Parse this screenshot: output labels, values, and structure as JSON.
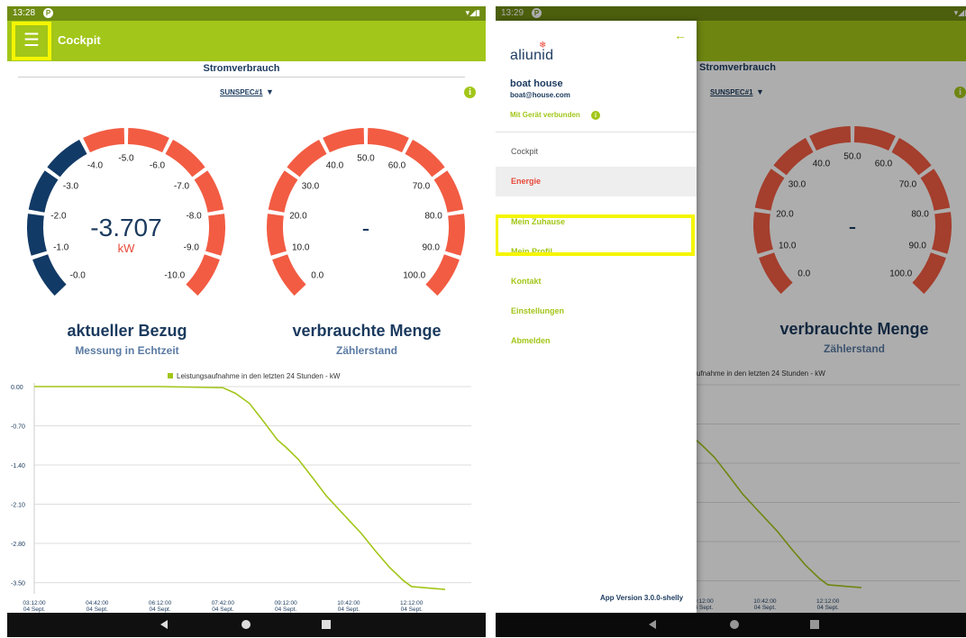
{
  "colors": {
    "accent": "#a2c619",
    "statusbar": "#6f8c13",
    "navy": "#1b3a5e",
    "gauge_red": "#f25c43",
    "gauge_blue": "#123a66",
    "highlight": "#f5f502"
  },
  "left_screen": {
    "status": {
      "time": "13:28",
      "icon": "P"
    },
    "appbar": {
      "menu_icon": "hamburger-icon",
      "title": "Cockpit"
    },
    "section_title": "Stromverbrauch",
    "device": "SUNSPEC#1",
    "device_caret": "▼",
    "info_icon": "i",
    "gauge1": {
      "ticks": [
        "-0.0",
        "-1.0",
        "-2.0",
        "-3.0",
        "-4.0",
        "-5.0",
        "-6.0",
        "-7.0",
        "-8.0",
        "-9.0",
        "-10.0"
      ],
      "value": "-3.707",
      "numeric_value": -3.707,
      "range": [
        0,
        -10
      ],
      "unit": "kW",
      "title": "aktueller Bezug",
      "subtitle": "Messung in Echtzeit"
    },
    "gauge2": {
      "ticks": [
        "0.0",
        "10.0",
        "20.0",
        "30.0",
        "40.0",
        "50.0",
        "60.0",
        "70.0",
        "80.0",
        "90.0",
        "100.0"
      ],
      "value": "-",
      "title": "verbrauchte Menge",
      "subtitle": "Zählerstand"
    },
    "legend": "Leistungsaufnahme in den letzten 24 Stunden - kW"
  },
  "right_screen": {
    "status": {
      "time": "13:29",
      "icon": "P"
    },
    "back_icon": "←",
    "logo": "aliunid",
    "user_name": "boat house",
    "user_email": "boat@house.com",
    "connection": "Mit Gerät verbunden",
    "connection_info": "i",
    "menu": [
      {
        "label": "Cockpit"
      },
      {
        "label": "Energie"
      },
      {
        "label": "Mein Zuhause"
      },
      {
        "label": "Mein Profil"
      },
      {
        "label": "Kontakt"
      },
      {
        "label": "Einstellungen"
      },
      {
        "label": "Abmelden"
      }
    ],
    "version": "App Version 3.0.0-shelly",
    "bg_section_title": "Stromverbrauch",
    "bg_gauge_title": "verbrauchte Menge",
    "bg_gauge_sub": "Zählerstand",
    "bg_legend": "ufnahme in den letzten 24 Stunden - kW"
  },
  "chart_data": {
    "type": "line",
    "legend": "Leistungsaufnahme in den letzten 24 Stunden - kW",
    "y_ticks": [
      "0.00",
      "-0.70",
      "-1.40",
      "-2.10",
      "-2.80",
      "-3.50"
    ],
    "x_ticks": [
      {
        "time": "03:12:00",
        "date": "04 Sept."
      },
      {
        "time": "04:42:00",
        "date": "04 Sept."
      },
      {
        "time": "06:12:00",
        "date": "04 Sept."
      },
      {
        "time": "07:42:00",
        "date": "04 Sept."
      },
      {
        "time": "09:12:00",
        "date": "04 Sept."
      },
      {
        "time": "10:42:00",
        "date": "04 Sept."
      },
      {
        "time": "12:12:00",
        "date": "04 Sept."
      }
    ],
    "ylim": [
      -3.7,
      0.0
    ],
    "x": [
      "03:12",
      "04:42",
      "06:12",
      "07:42",
      "08:00",
      "08:20",
      "08:40",
      "09:00",
      "09:12",
      "09:30",
      "09:50",
      "10:10",
      "10:30",
      "10:42",
      "11:00",
      "11:20",
      "11:40",
      "12:00",
      "12:12",
      "12:40",
      "13:00"
    ],
    "values": [
      0.0,
      0.0,
      0.0,
      -0.02,
      -0.12,
      -0.3,
      -0.62,
      -0.95,
      -1.08,
      -1.3,
      -1.62,
      -1.95,
      -2.22,
      -2.38,
      -2.62,
      -2.93,
      -3.22,
      -3.46,
      -3.57,
      -3.6,
      -3.62
    ],
    "series_color": "#a2c619",
    "grid": true
  }
}
